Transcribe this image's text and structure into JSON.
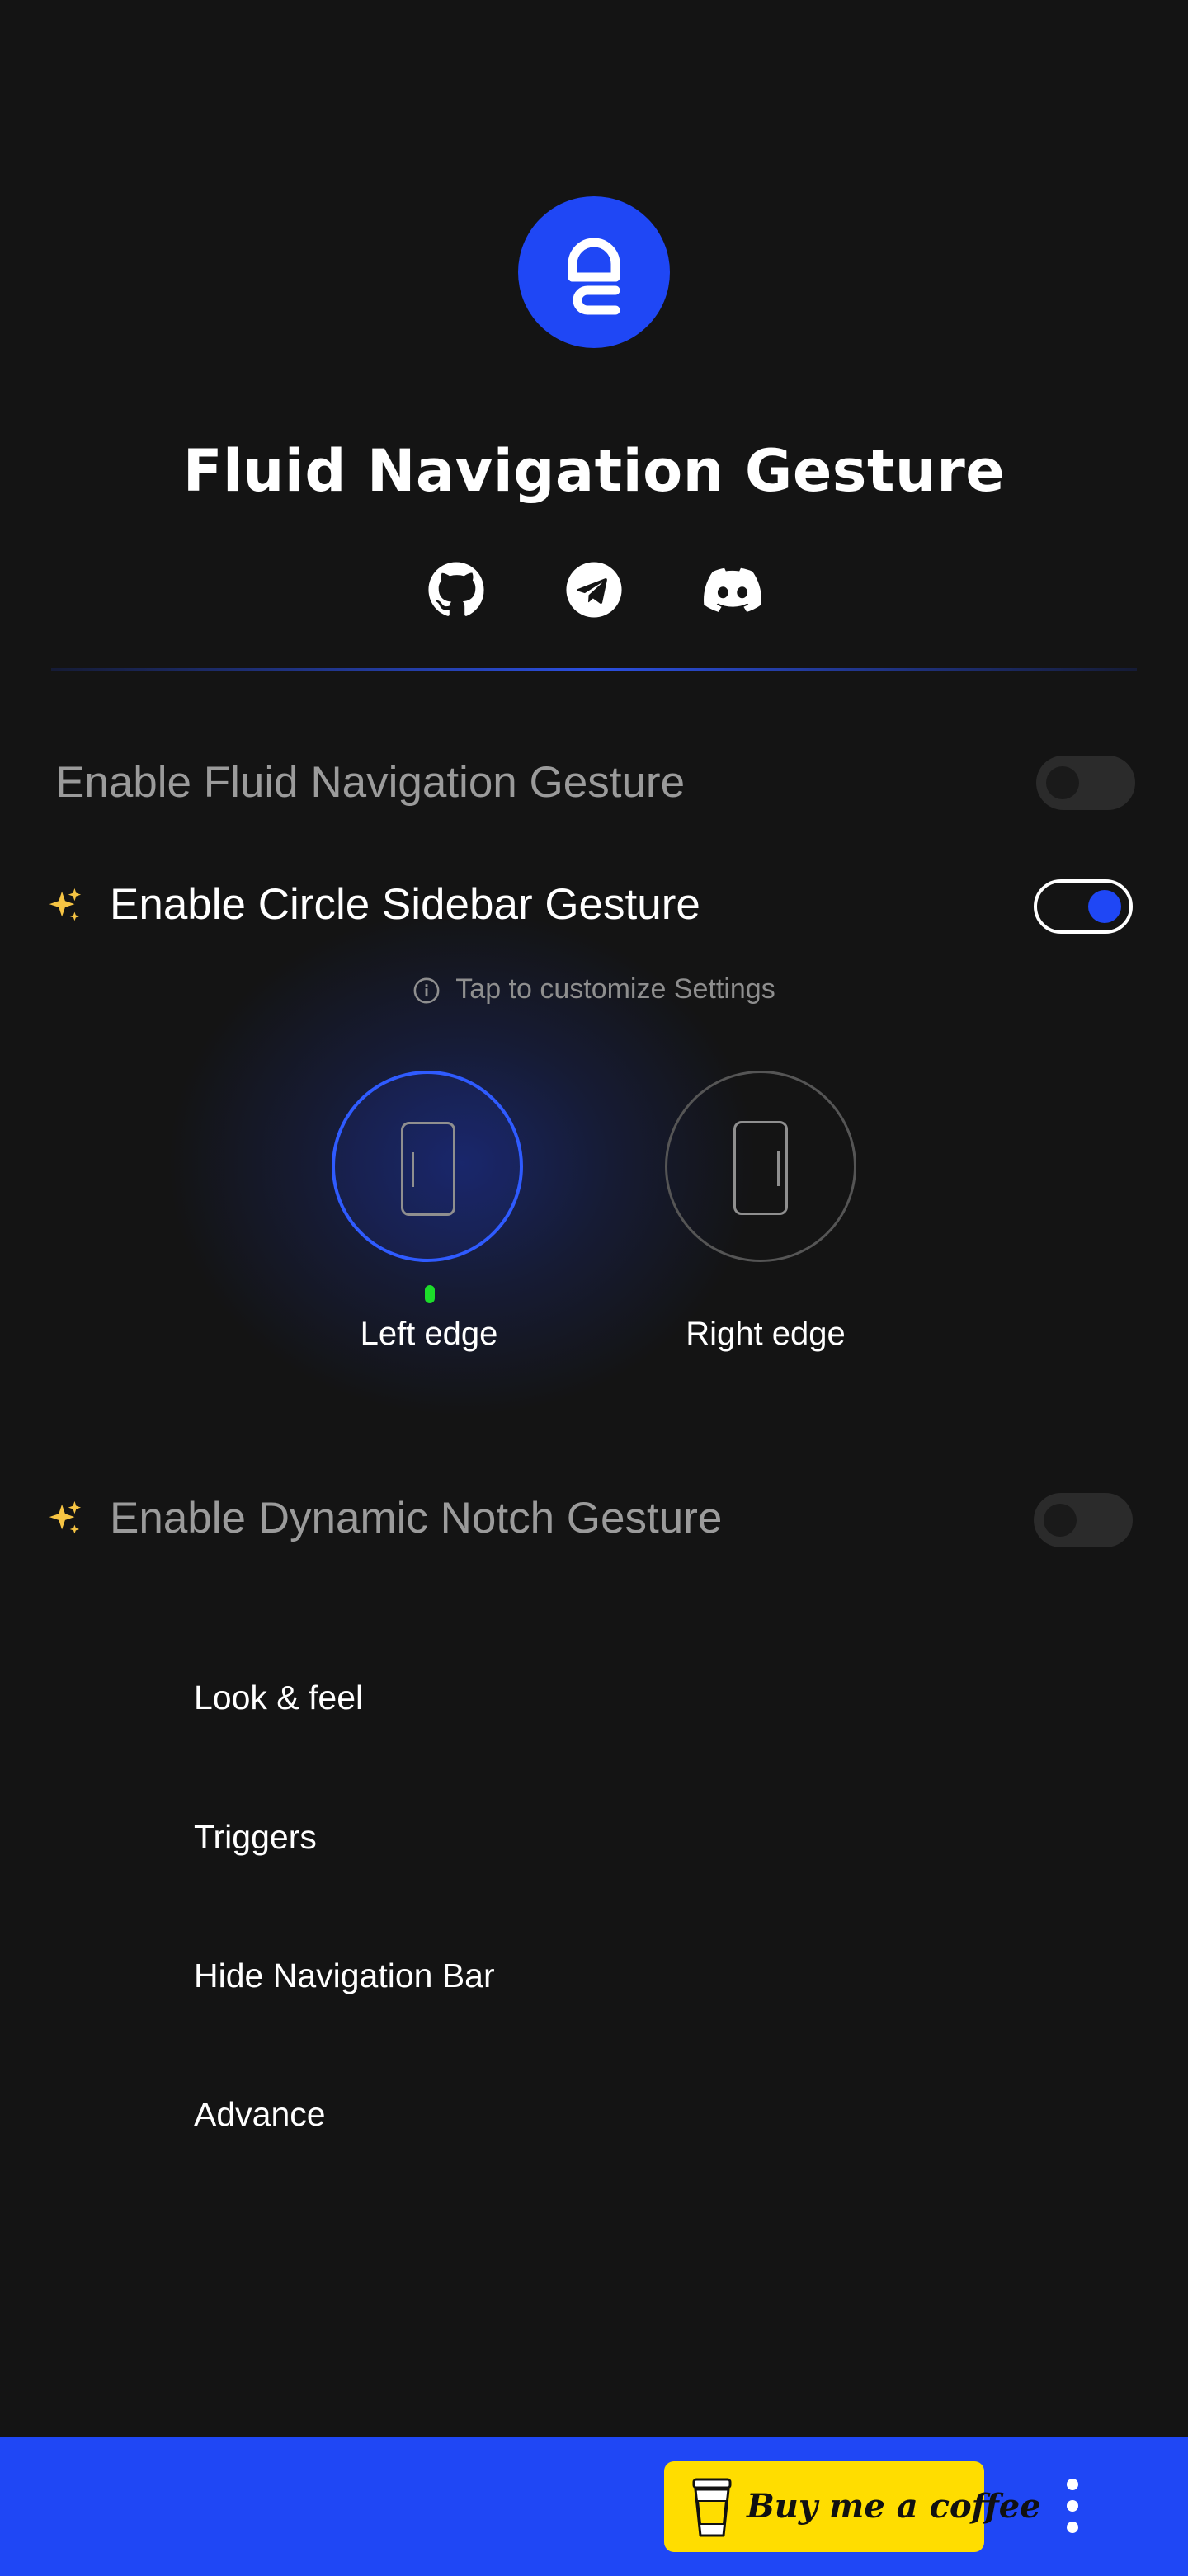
{
  "app": {
    "title": "Fluid Navigation Gesture",
    "logo_icon": "fluid-logo-icon",
    "accent_color": "#1f47f5"
  },
  "social_links": [
    {
      "icon": "github-icon"
    },
    {
      "icon": "telegram-icon"
    },
    {
      "icon": "discord-icon"
    }
  ],
  "settings": {
    "fluid_nav": {
      "label": "Enable Fluid Navigation Gesture",
      "enabled": false
    },
    "circle_sidebar": {
      "label": "Enable Circle Sidebar Gesture",
      "enabled": true,
      "icon": "sparkles-icon"
    },
    "hint": "Tap to customize Settings",
    "edges": [
      {
        "label": "Left edge",
        "selected": true,
        "active_indicator_color": "#1cdc2a"
      },
      {
        "label": "Right edge",
        "selected": false
      }
    ],
    "dynamic_notch": {
      "label": "Enable Dynamic Notch Gesture",
      "enabled": false,
      "icon": "sparkles-icon"
    }
  },
  "menu": [
    {
      "label": "Look & feel"
    },
    {
      "label": "Triggers"
    },
    {
      "label": "Hide Navigation Bar"
    },
    {
      "label": "Advance"
    }
  ],
  "bottom_bar": {
    "coffee_label": "Buy me a coffee",
    "coffee_icon": "coffee-cup-icon",
    "more_icon": "more-vertical-icon",
    "bar_color": "#1f47f5",
    "coffee_color": "#ffdd00"
  }
}
